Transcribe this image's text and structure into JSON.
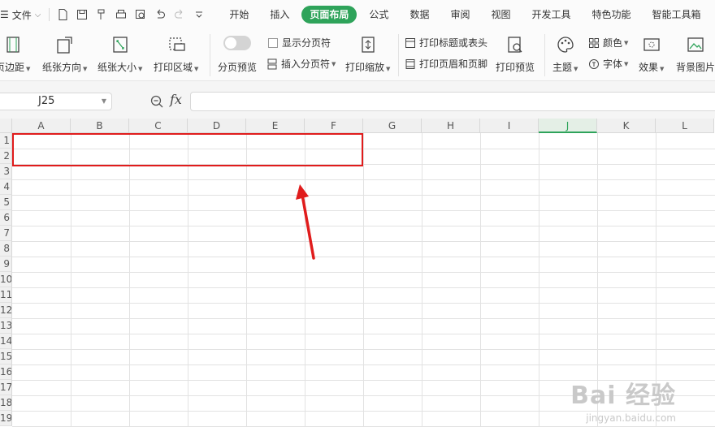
{
  "menubar": {
    "file_label": "文件",
    "tabs": [
      {
        "label": "开始"
      },
      {
        "label": "插入"
      },
      {
        "label": "页面布局",
        "active": true
      },
      {
        "label": "公式"
      },
      {
        "label": "数据"
      },
      {
        "label": "审阅"
      },
      {
        "label": "视图"
      },
      {
        "label": "开发工具"
      },
      {
        "label": "特色功能"
      },
      {
        "label": "智能工具箱"
      }
    ]
  },
  "ribbon": {
    "margins": "页边距",
    "orientation": "纸张方向",
    "size": "纸张大小",
    "print_area": "打印区域",
    "page_break_preview": "分页预览",
    "show_page_breaks": "显示分页符",
    "insert_page_break": "插入分页符",
    "print_scale": "打印缩放",
    "print_titles": "打印标题或表头",
    "header_footer": "打印页眉和页脚",
    "print_preview": "打印预览",
    "theme": "主题",
    "colors": "颜色",
    "fonts": "字体",
    "effects": "效果",
    "background": "背景图片"
  },
  "formula_bar": {
    "name_box": "J25",
    "fx": "fx",
    "value": ""
  },
  "grid": {
    "columns": [
      "A",
      "B",
      "C",
      "D",
      "E",
      "F",
      "G",
      "H",
      "I",
      "J",
      "K",
      "L"
    ],
    "selected_column": "J",
    "rows": [
      "1",
      "2",
      "3",
      "4",
      "5",
      "6",
      "7",
      "8",
      "9",
      "10",
      "11",
      "12",
      "13",
      "14",
      "15",
      "16",
      "17",
      "18",
      "19"
    ]
  },
  "watermark": {
    "brand": "Bai 经验",
    "url": "jingyan.baidu.com"
  },
  "colors": {
    "accent": "#2ea35a",
    "highlight": "#e01c1c"
  }
}
